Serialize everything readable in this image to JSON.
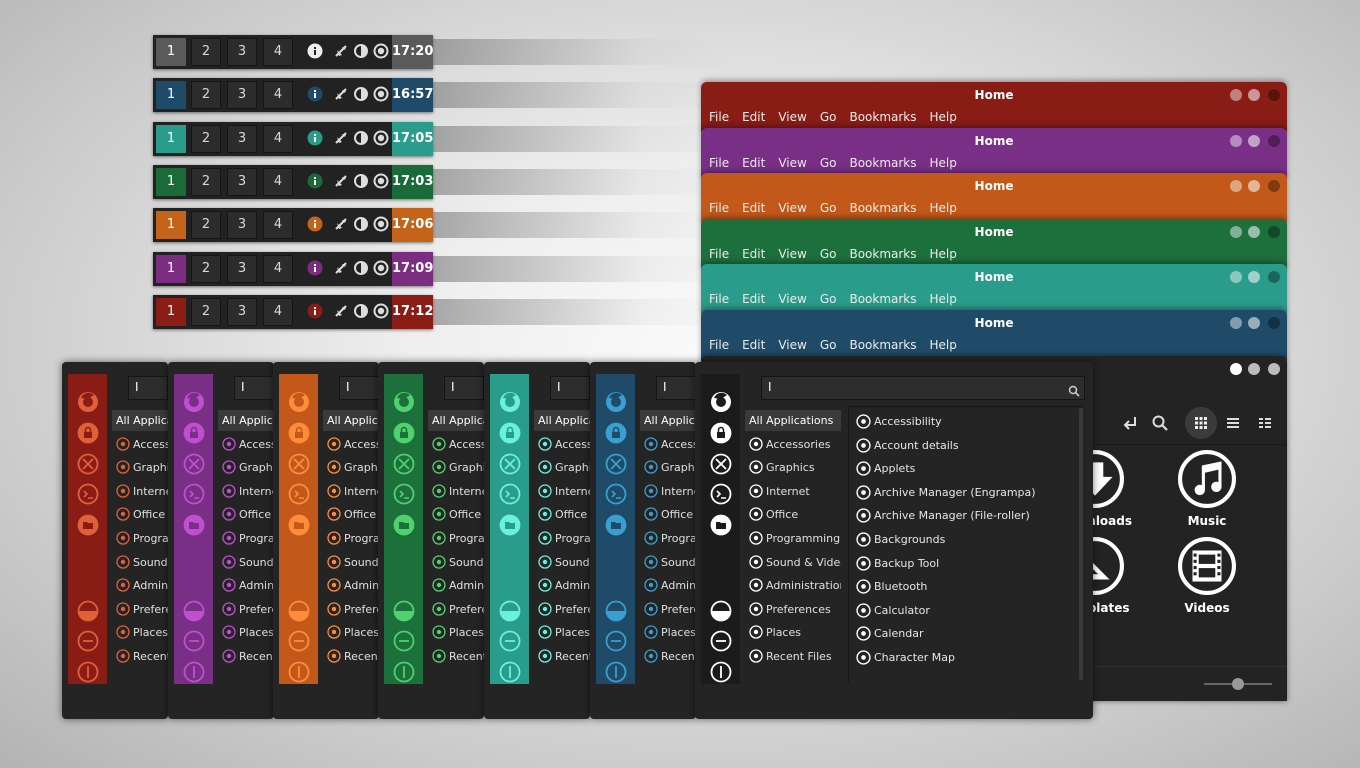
{
  "panels": [
    {
      "accent": "#5a5a5a",
      "clock": "17:20",
      "workspaces": [
        "1",
        "2",
        "3",
        "4"
      ]
    },
    {
      "accent": "#1f4a68",
      "clock": "16:57",
      "workspaces": [
        "1",
        "2",
        "3",
        "4"
      ]
    },
    {
      "accent": "#2a9c8c",
      "clock": "17:05",
      "workspaces": [
        "1",
        "2",
        "3",
        "4"
      ]
    },
    {
      "accent": "#1b6b39",
      "clock": "17:03",
      "workspaces": [
        "1",
        "2",
        "3",
        "4"
      ]
    },
    {
      "accent": "#c4631a",
      "clock": "17:06",
      "workspaces": [
        "1",
        "2",
        "3",
        "4"
      ]
    },
    {
      "accent": "#7c2d82",
      "clock": "17:09",
      "workspaces": [
        "1",
        "2",
        "3",
        "4"
      ]
    },
    {
      "accent": "#8c1c16",
      "clock": "17:12",
      "workspaces": [
        "1",
        "2",
        "3",
        "4"
      ]
    }
  ],
  "file_windows": [
    {
      "accent": "#8a1c16",
      "title": "Home"
    },
    {
      "accent": "#7a2f86",
      "title": "Home"
    },
    {
      "accent": "#c2591a",
      "title": "Home"
    },
    {
      "accent": "#1d6f3c",
      "title": "Home"
    },
    {
      "accent": "#2a9c8c",
      "title": "Home"
    },
    {
      "accent": "#1f4a68",
      "title": "Home"
    }
  ],
  "file_menu": [
    "File",
    "Edit",
    "View",
    "Go",
    "Bookmarks",
    "Help"
  ],
  "file_main": {
    "items": [
      {
        "label": "Downloads",
        "icon": "download-icon"
      },
      {
        "label": "Music",
        "icon": "music-icon"
      },
      {
        "label": "Templates",
        "icon": "template-icon"
      },
      {
        "label": "Videos",
        "icon": "video-icon"
      }
    ]
  },
  "menus": [
    {
      "accent": "#8a1c16",
      "icon": "#e0603a"
    },
    {
      "accent": "#7a2f86",
      "icon": "#c04fd0"
    },
    {
      "accent": "#c2591a",
      "icon": "#ff8c3a"
    },
    {
      "accent": "#1d6f3c",
      "icon": "#4fd26e"
    },
    {
      "accent": "#2a9c8c",
      "icon": "#6af0de"
    },
    {
      "accent": "#1f4a68",
      "icon": "#3a9fd0"
    },
    {
      "accent": "#1b1b1b",
      "icon": "#ffffff"
    }
  ],
  "menu": {
    "search_text": "I",
    "categories": [
      "All Applications",
      "Accessories",
      "Graphics",
      "Internet",
      "Office",
      "Programming",
      "Sound & Video",
      "Administration",
      "Preferences",
      "Places",
      "Recent Files"
    ],
    "apps": [
      "Accessibility",
      "Account details",
      "Applets",
      "Archive Manager (Engrampa)",
      "Archive Manager (File-roller)",
      "Backgrounds",
      "Backup Tool",
      "Bluetooth",
      "Calculator",
      "Calendar",
      "Character Map"
    ]
  }
}
